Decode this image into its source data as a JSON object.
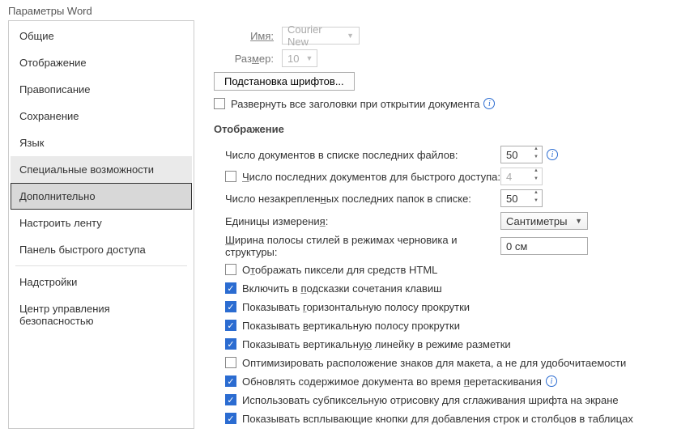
{
  "title": "Параметры Word",
  "nav": {
    "general": "Общие",
    "display": "Отображение",
    "proofing": "Правописание",
    "save": "Сохранение",
    "language": "Язык",
    "accessibility": "Специальные возможности",
    "advanced": "Дополнительно",
    "customize_ribbon": "Настроить ленту",
    "quick_access": "Панель быстрого доступа",
    "addins": "Надстройки",
    "trust_center": "Центр управления безопасностью"
  },
  "top": {
    "name_label": "Имя:",
    "name_value": "Courier New",
    "size_label": "Размер:",
    "size_value": "10",
    "subst_button": "Подстановка шрифтов...",
    "expand_headings": "Развернуть все заголовки при открытии документа"
  },
  "section_display": "Отображение",
  "fields": {
    "recent_docs_label": "Число документов в списке последних файлов:",
    "recent_docs_value": "50",
    "quick_access_label": "Число последних документов для быстрого доступа:",
    "quick_access_value": "4",
    "unpinned_folders_label": "Число незакрепленных последних папок в списке:",
    "unpinned_folders_value": "50",
    "units_label": "Единицы измерения:",
    "units_value": "Сантиметры",
    "style_width_label": "Ширина полосы стилей в режимах черновика и структуры:",
    "style_width_value": "0 см"
  },
  "checks": {
    "pixels_html": "Отображать пиксели для средств HTML",
    "shortcuts": "Включить в подсказки сочетания клавиш",
    "hscroll": "Показывать горизонтальную полосу прокрутки",
    "vscroll": "Показывать вертикальную полосу прокрутки",
    "vruler": "Показывать вертикальную линейку в режиме разметки",
    "optimize_layout": "Оптимизировать расположение знаков для макета, а не для удобочитаемости",
    "update_drag": "Обновлять содержимое документа во время перетаскивания",
    "subpixel": "Использовать субпиксельную отрисовку для сглаживания шрифта на экране",
    "insert_buttons": "Показывать всплывающие кнопки для добавления строк и столбцов в таблицах"
  }
}
